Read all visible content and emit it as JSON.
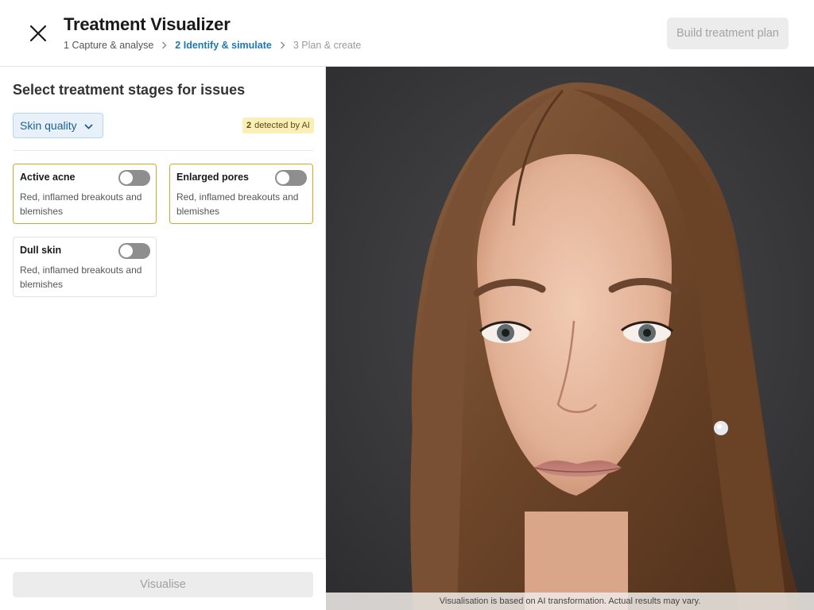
{
  "header": {
    "title": "Treatment Visualizer",
    "steps": [
      {
        "number": "1",
        "label": "Capture & analyse"
      },
      {
        "number": "2",
        "label": "Identify & simulate"
      },
      {
        "number": "3",
        "label": "Plan & create"
      }
    ],
    "build_button": "Build treatment plan"
  },
  "panel": {
    "title": "Select treatment stages for issues",
    "category": "Skin quality",
    "ai_badge": {
      "count": "2",
      "label": "detected by AI"
    },
    "cards": [
      {
        "title": "Active acne",
        "description": "Red, inflamed breakouts and blemishes",
        "detected": true,
        "enabled": false
      },
      {
        "title": "Enlarged pores",
        "description": "Red, inflamed breakouts and blemishes",
        "detected": true,
        "enabled": false
      },
      {
        "title": "Dull skin",
        "description": "Red, inflamed breakouts and blemishes",
        "detected": false,
        "enabled": false
      }
    ],
    "visualise_button": "Visualise"
  },
  "photo": {
    "disclaimer": "Visualisation is based on AI transformation. Actual results may vary."
  },
  "colors": {
    "accent": "#1f78b4",
    "detected_border": "#d4a72c",
    "badge_bg": "#fbefb8"
  }
}
